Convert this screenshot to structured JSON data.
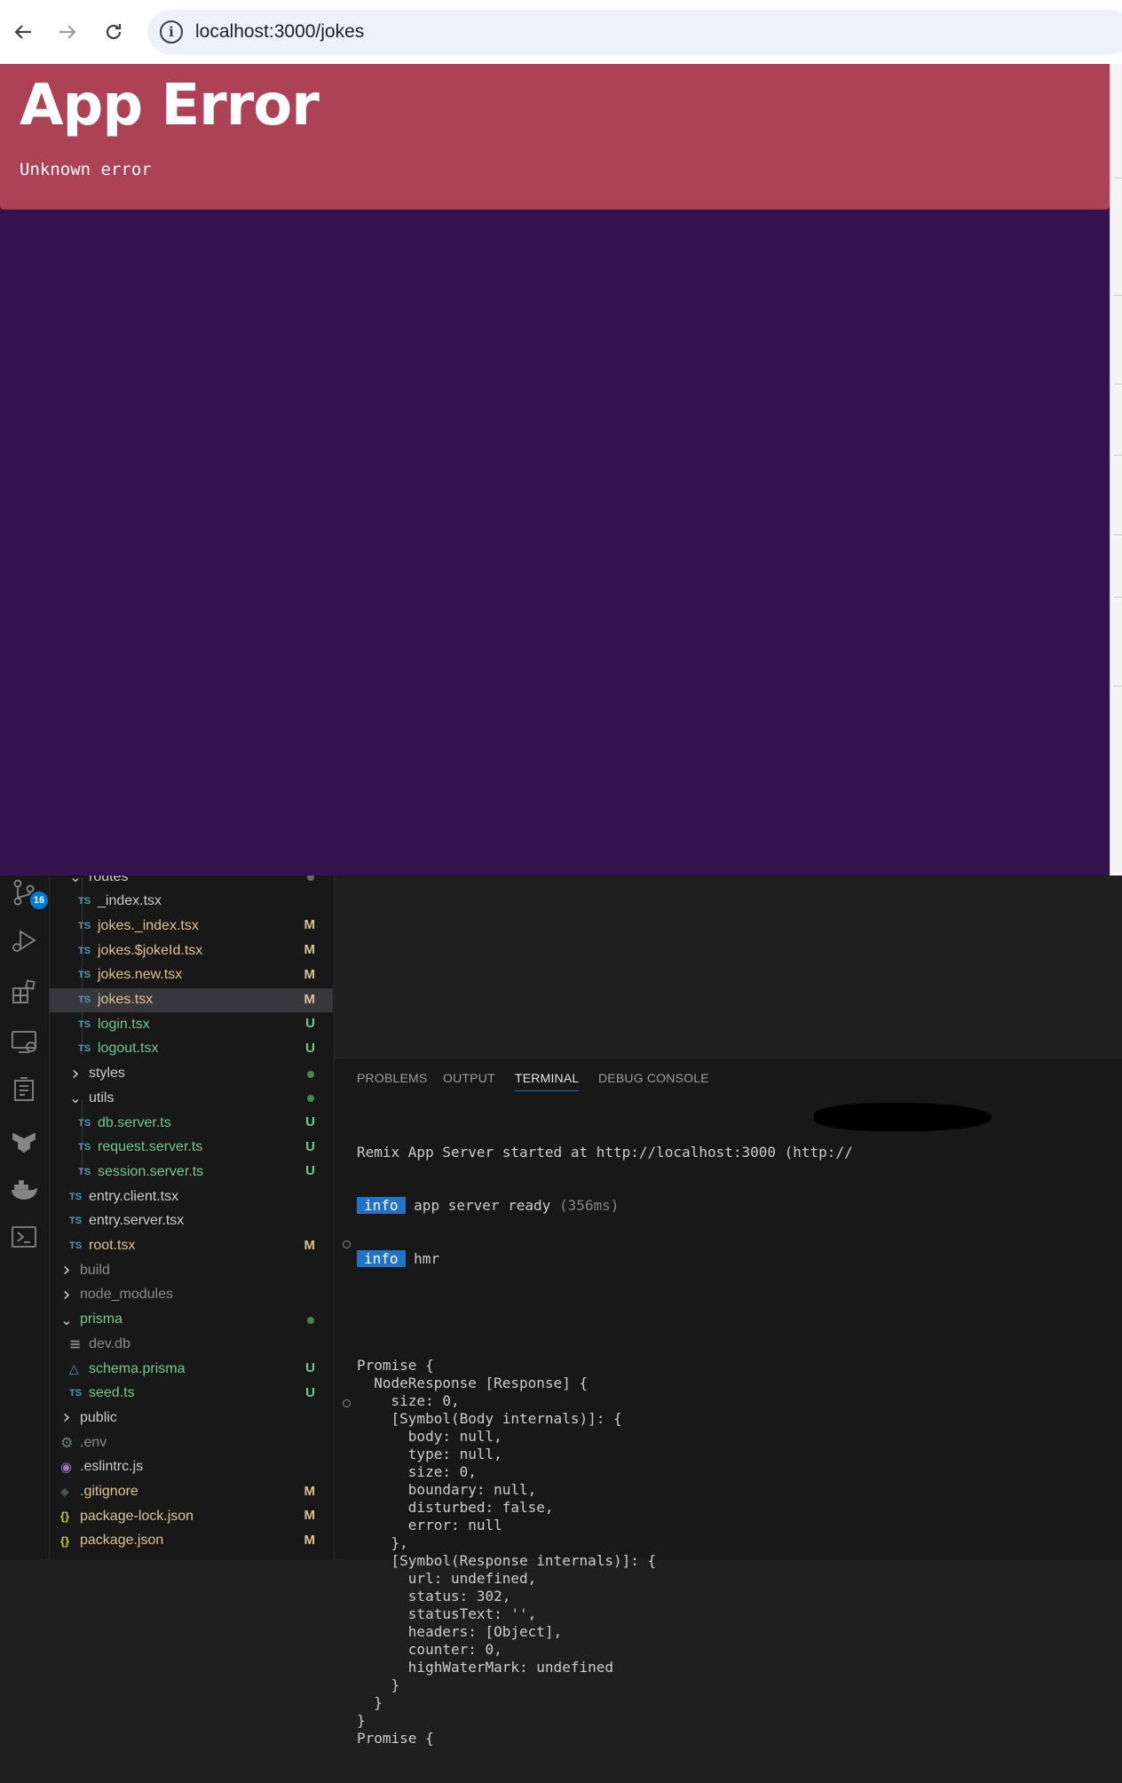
{
  "browser": {
    "back_icon": "arrow-left-icon",
    "forward_icon": "arrow-right-icon",
    "reload_icon": "reload-icon",
    "site_info_icon": "info-icon",
    "url": "localhost:3000/jokes"
  },
  "page": {
    "error_title": "App Error",
    "error_message": "Unknown error",
    "colors": {
      "background": "#34124d",
      "error_box": "#ad4155"
    }
  },
  "activity_bar": {
    "items": [
      "source-control-icon",
      "run-debug-icon",
      "extensions-icon",
      "remote-explorer-icon",
      "testing-icon",
      "azure-icon",
      "docker-icon",
      "terminal-icon"
    ],
    "source_control_badge": "16"
  },
  "explorer": {
    "items": [
      {
        "label": "routes",
        "type": "folder-open",
        "icon": "chevron-down-icon",
        "status": "",
        "dot": "gray"
      },
      {
        "label": "_index.tsx",
        "type": "ts",
        "icon": "TS",
        "status": "",
        "color": "#cccccc"
      },
      {
        "label": "jokes._index.tsx",
        "type": "ts",
        "icon": "TS",
        "status": "M",
        "color": "#e2c08d"
      },
      {
        "label": "jokes.$jokeId.tsx",
        "type": "ts",
        "icon": "TS",
        "status": "M",
        "color": "#e2c08d"
      },
      {
        "label": "jokes.new.tsx",
        "type": "ts",
        "icon": "TS",
        "status": "M",
        "color": "#e2c08d"
      },
      {
        "label": "jokes.tsx",
        "type": "ts",
        "icon": "TS",
        "status": "M",
        "color": "#e2c08d"
      },
      {
        "label": "login.tsx",
        "type": "ts",
        "icon": "TS",
        "status": "U",
        "color": "#73c991"
      },
      {
        "label": "logout.tsx",
        "type": "ts",
        "icon": "TS",
        "status": "U",
        "color": "#73c991"
      },
      {
        "label": "styles",
        "type": "folder",
        "icon": "chevron-right-icon",
        "status": "",
        "dot": "green"
      },
      {
        "label": "utils",
        "type": "folder-open",
        "icon": "chevron-down-icon",
        "status": "",
        "dot": "green"
      },
      {
        "label": "db.server.ts",
        "type": "ts",
        "icon": "TS",
        "status": "U",
        "color": "#73c991"
      },
      {
        "label": "request.server.ts",
        "type": "ts",
        "icon": "TS",
        "status": "U",
        "color": "#73c991"
      },
      {
        "label": "session.server.ts",
        "type": "ts",
        "icon": "TS",
        "status": "U",
        "color": "#73c991"
      },
      {
        "label": "entry.client.tsx",
        "type": "ts",
        "icon": "TS",
        "status": "",
        "color": "#cccccc"
      },
      {
        "label": "entry.server.tsx",
        "type": "ts",
        "icon": "TS",
        "status": "",
        "color": "#cccccc"
      },
      {
        "label": "root.tsx",
        "type": "ts",
        "icon": "TS",
        "status": "M",
        "color": "#e2c08d"
      },
      {
        "label": "build",
        "type": "folder",
        "icon": "chevron-right-icon",
        "status": "",
        "color": "#8c8c8c"
      },
      {
        "label": "node_modules",
        "type": "folder",
        "icon": "chevron-right-icon",
        "status": "",
        "color": "#8c8c8c"
      },
      {
        "label": "prisma",
        "type": "folder-open",
        "icon": "chevron-down-icon",
        "status": "",
        "dot": "green",
        "color": "#73c991"
      },
      {
        "label": "dev.db",
        "type": "file",
        "icon": "file-lines-icon",
        "status": "",
        "color": "#8c8c8c"
      },
      {
        "label": "schema.prisma",
        "type": "prisma",
        "icon": "prisma-icon",
        "status": "U",
        "color": "#73c991"
      },
      {
        "label": "seed.ts",
        "type": "ts",
        "icon": "TS",
        "status": "U",
        "color": "#73c991"
      },
      {
        "label": "public",
        "type": "folder",
        "icon": "chevron-right-icon",
        "status": "",
        "color": "#cccccc"
      },
      {
        "label": ".env",
        "type": "gear",
        "icon": "gear-icon",
        "status": "",
        "color": "#8c8c8c"
      },
      {
        "label": ".eslintrc.js",
        "type": "eslint",
        "icon": "eslint-icon",
        "status": "",
        "color": "#cccccc"
      },
      {
        "label": ".gitignore",
        "type": "git",
        "icon": "git-icon",
        "status": "M",
        "color": "#e2c08d"
      },
      {
        "label": "package-lock.json",
        "type": "json",
        "icon": "{}",
        "status": "M",
        "color": "#e2c08d"
      },
      {
        "label": "package.json",
        "type": "json",
        "icon": "{}",
        "status": "M",
        "color": "#e2c08d"
      }
    ]
  },
  "panel": {
    "tabs": [
      "PROBLEMS",
      "OUTPUT",
      "TERMINAL",
      "DEBUG CONSOLE"
    ],
    "active_tab": "TERMINAL"
  },
  "terminal": {
    "server_line": "Remix App Server started at http://localhost:3000 (http://",
    "info_label": "info",
    "ready_text": "app server ready",
    "ready_time": "(356ms)",
    "hmr_text": "hmr",
    "output_lines": [
      "Promise {",
      "  NodeResponse [Response] {",
      "    size: 0,",
      "    [Symbol(Body internals)]: {",
      "      body: null,",
      "      type: null,",
      "      size: 0,",
      "      boundary: null,",
      "      disturbed: false,",
      "      error: null",
      "    },",
      "    [Symbol(Response internals)]: {",
      "      url: undefined,",
      "      status: 302,",
      "      statusText: '',",
      "      headers: [Object],",
      "      counter: 0,",
      "      highWaterMark: undefined",
      "    }",
      "  }",
      "}",
      "Promise {"
    ]
  }
}
